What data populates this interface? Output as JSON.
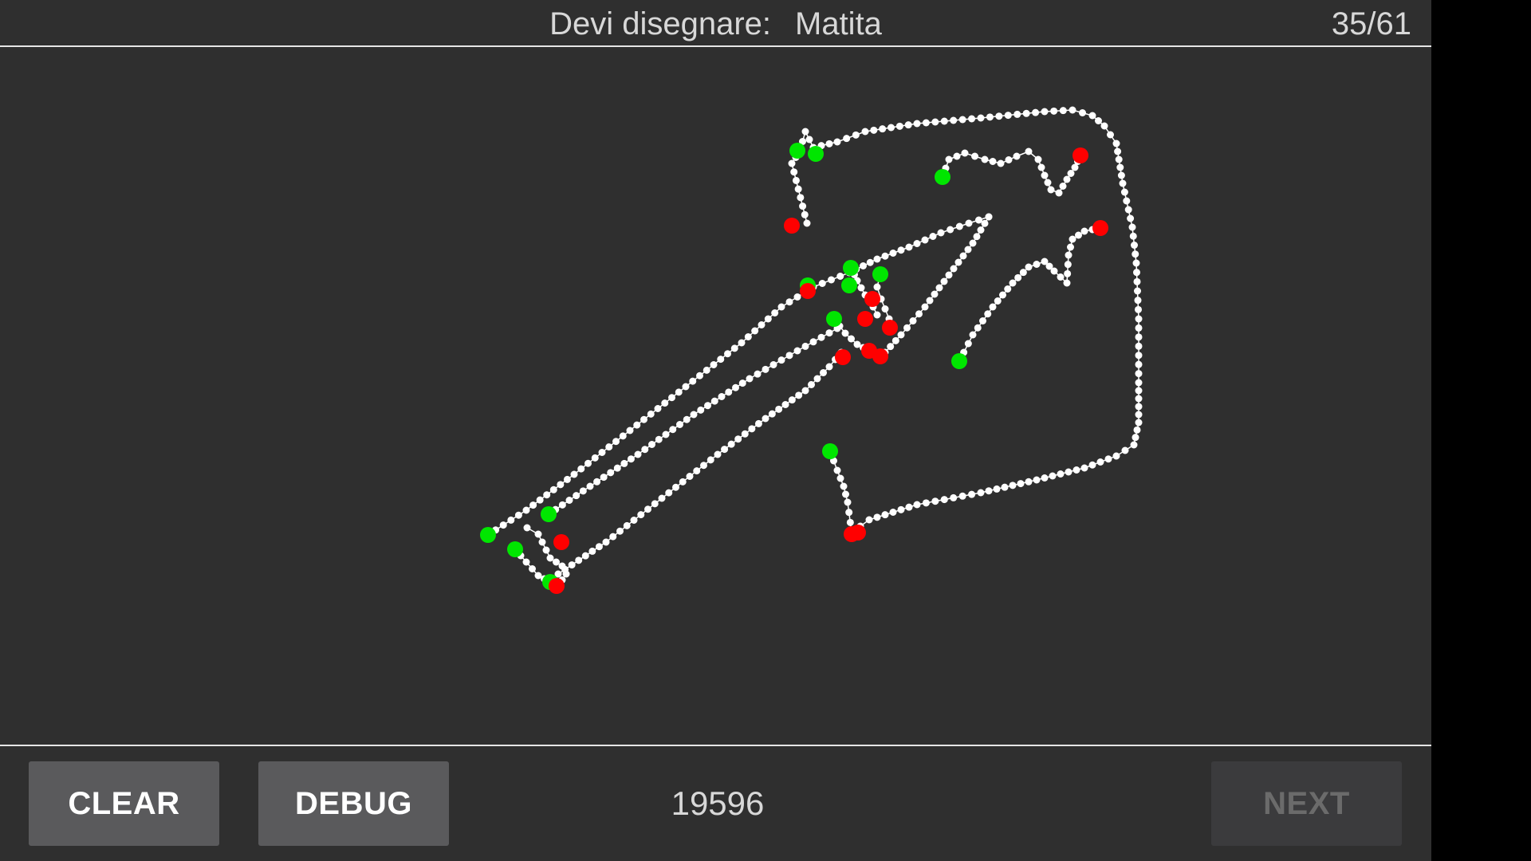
{
  "header": {
    "prompt_label": "Devi disegnare:",
    "prompt_word": "Matita",
    "counter": "35/61"
  },
  "footer": {
    "clear_label": "CLEAR",
    "debug_label": "DEBUG",
    "score": "19596",
    "next_label": "NEXT"
  },
  "colors": {
    "background": "#2f2f2f",
    "stroke": "#ffffff",
    "stroke_start": "#00e600",
    "stroke_end": "#ff0000",
    "button": "#5a5a5c",
    "button_disabled": "#3b3b3d"
  }
}
